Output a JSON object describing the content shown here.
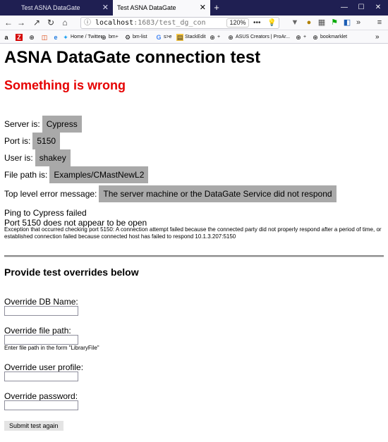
{
  "browser": {
    "tabs": [
      {
        "title": "Test ASNA DataGate",
        "active": false
      },
      {
        "title": "Test ASNA DataGate",
        "active": true
      }
    ],
    "url_host": "localhost",
    "url_rest": ":1683/test_dg_con",
    "zoom": "120%",
    "bookmarks": [
      {
        "label": "",
        "icon": "amazon-icon"
      },
      {
        "label": "",
        "icon": "z-icon"
      },
      {
        "label": "",
        "icon": "globe-icon"
      },
      {
        "label": "",
        "icon": "office-icon"
      },
      {
        "label": "",
        "icon": "ie-icon"
      },
      {
        "label": "Home / Twitter",
        "icon": "twitter-icon"
      },
      {
        "label": "bm+",
        "icon": "globe-icon"
      },
      {
        "label": "bm-list",
        "icon": "bm-list-icon"
      },
      {
        "label": "s>e",
        "icon": "google-icon"
      },
      {
        "label": "StackEdit",
        "icon": "stackedit-icon"
      },
      {
        "label": "+",
        "icon": "globe-icon"
      },
      {
        "label": "ASUS Creators | ProAr...",
        "icon": "asus-icon"
      },
      {
        "label": "+",
        "icon": "globe-icon"
      },
      {
        "label": "bookmarklet",
        "icon": "globe-icon"
      }
    ]
  },
  "page": {
    "title": "ASNA DataGate connection test",
    "error_heading": "Something is wrong",
    "fields": [
      {
        "label": "Server is:",
        "value": "Cypress"
      },
      {
        "label": "Port is:",
        "value": "5150"
      },
      {
        "label": "User is:",
        "value": "shakey"
      },
      {
        "label": "File path is:",
        "value": "Examples/CMastNewL2"
      },
      {
        "label": "Top level error message:",
        "value": "The server machine or the DataGate Service did not respond"
      }
    ],
    "ping_message": "Ping to Cypress failed",
    "port_message": "Port 5150 does not appear to be open",
    "exception_message": "Exception that occurred checking port 5150: A connection attempt failed because the connected party did not properly respond after a period of time, or established connection failed because connected host has failed to respond 10.1.3.207:5150",
    "overrides_heading": "Provide test overrides below",
    "overrides": {
      "db_name_label": "Override DB Name:",
      "db_name_value": "",
      "file_path_label": "Override file path:",
      "file_path_value": "",
      "file_path_hint": "Enter file path in the form \"LibraryFile\"",
      "user_label": "Override user profile:",
      "user_value": "",
      "password_label": "Override password:",
      "password_value": ""
    },
    "submit_label": "Submit test again"
  }
}
